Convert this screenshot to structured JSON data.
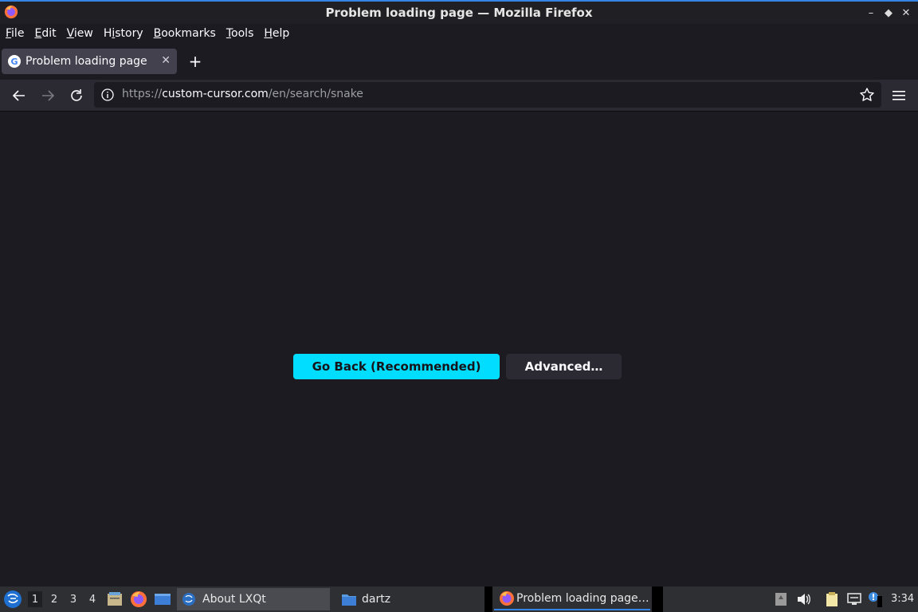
{
  "window": {
    "title": "Problem loading page — Mozilla Firefox"
  },
  "menubar": {
    "items": [
      {
        "label": "File",
        "key": "F",
        "rest": "ile"
      },
      {
        "label": "Edit",
        "key": "E",
        "rest": "dit"
      },
      {
        "label": "View",
        "key": "V",
        "rest": "iew"
      },
      {
        "label": "History",
        "key": "H",
        "rest": "istory"
      },
      {
        "label": "Bookmarks",
        "key": "B",
        "rest": "ookmarks"
      },
      {
        "label": "Tools",
        "key": "T",
        "rest": "ools"
      },
      {
        "label": "Help",
        "key": "H",
        "rest": "elp"
      }
    ]
  },
  "tabs": [
    {
      "label": "Problem loading page",
      "icon": "google-icon"
    }
  ],
  "urlbar": {
    "scheme": "https://",
    "host": "custom-cursor.com",
    "path": "/en/search/snake"
  },
  "content": {
    "go_back_label": "Go Back (Recommended)",
    "advanced_label": "Advanced…"
  },
  "taskbar": {
    "desktops": [
      "1",
      "2",
      "3",
      "4"
    ],
    "tasks": {
      "about": "About LXQt",
      "dartz": "dartz",
      "firefox": "Problem loading page…"
    },
    "clock": "3:34"
  },
  "colors": {
    "accent": "#00ddff",
    "background": "#1c1b22",
    "toolbar": "#2b2a33"
  }
}
